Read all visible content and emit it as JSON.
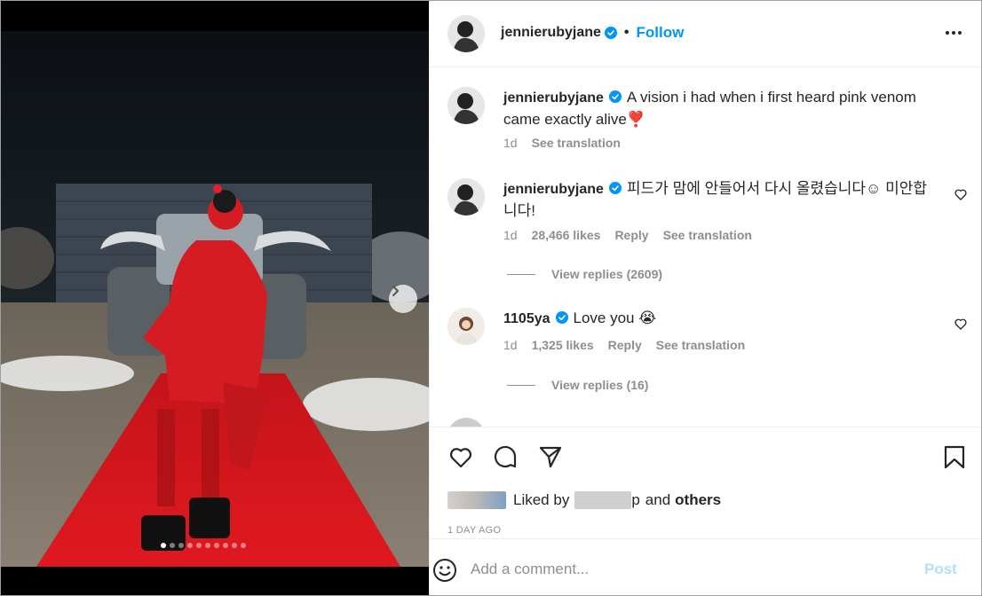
{
  "post": {
    "username": "jennierubyjane",
    "follow_label": "Follow",
    "separator": "•",
    "more_icon": "more-horizontal-icon",
    "verified_color": "#0095f6",
    "accent_color": "#0095f6"
  },
  "media": {
    "carousel_count": 10,
    "carousel_active": 1,
    "next_icon": "chevron-right-icon"
  },
  "caption": {
    "username": "jennierubyjane",
    "text": "A vision i had when i first heard pink venom came exactly alive❣️",
    "time": "1d",
    "translate": "See translation"
  },
  "comments": [
    {
      "username": "jennierubyjane",
      "text": "피드가 맘에 안들어서 다시 올렸습니다☺ 미안합니다!",
      "time": "1d",
      "likes": "28,466 likes",
      "reply": "Reply",
      "translate": "See translation",
      "replies": "View replies (2609)"
    },
    {
      "username": "1105ya",
      "text": "Love you 😭",
      "time": "1d",
      "likes": "1,325 likes",
      "reply": "Reply",
      "translate": "See translation",
      "replies": "View replies (16)"
    }
  ],
  "actions": {
    "like_icon": "heart-icon",
    "comment_icon": "comment-bubble-icon",
    "share_icon": "send-paper-plane-icon",
    "save_icon": "bookmark-icon",
    "liked_by_prefix": "Liked by",
    "liked_by_suffix": "p",
    "liked_by_and": "and",
    "liked_by_others": "others",
    "time_ago": "1 DAY AGO"
  },
  "comment_box": {
    "emoji_icon": "emoji-smile-icon",
    "placeholder": "Add a comment...",
    "post_label": "Post"
  }
}
